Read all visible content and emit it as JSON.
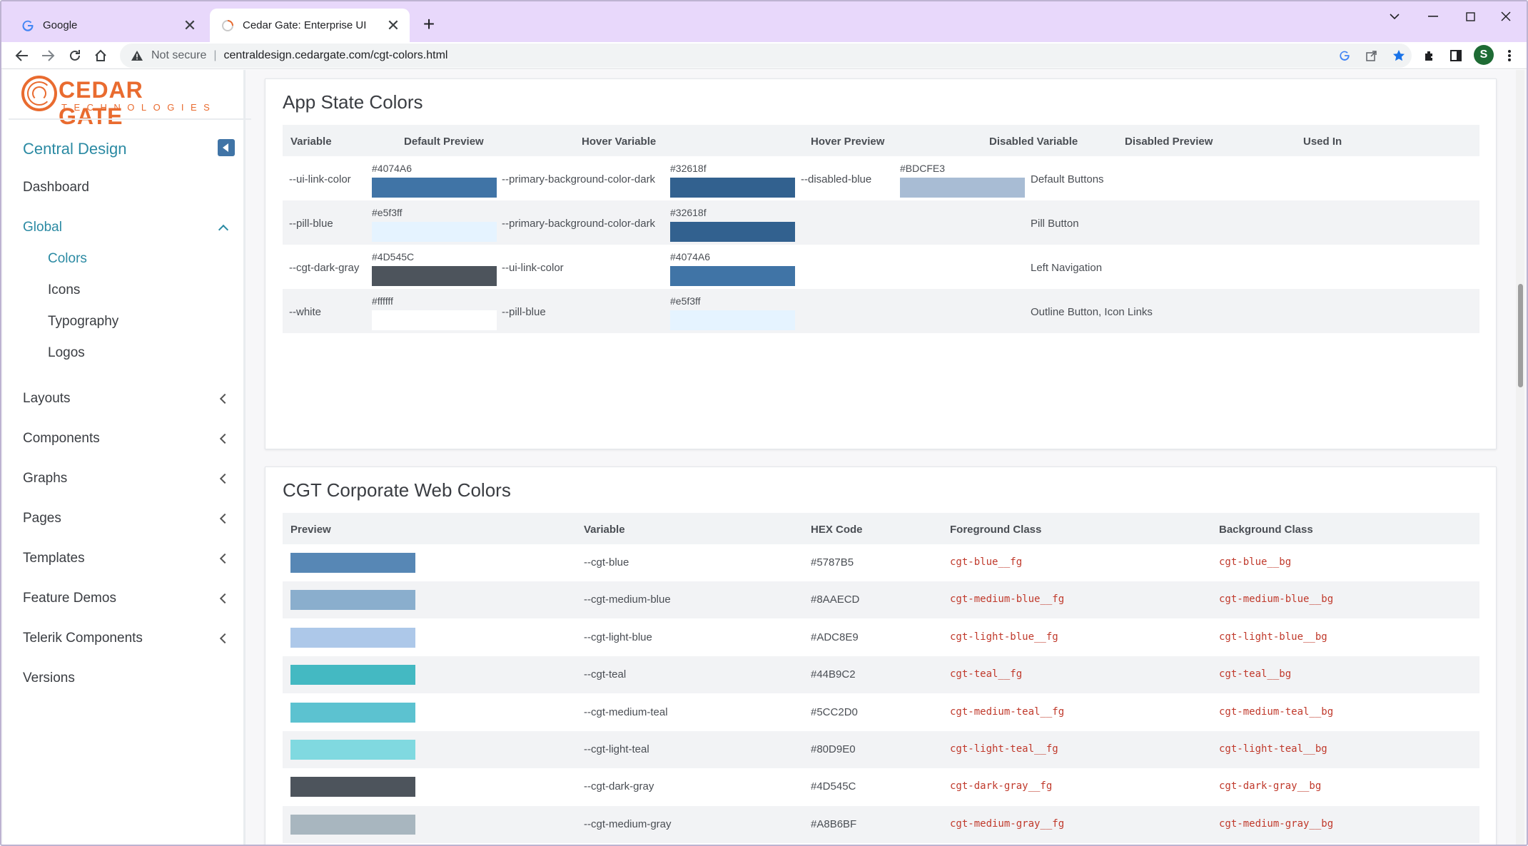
{
  "browser": {
    "tabs": [
      {
        "title": "Google",
        "favicon": "google-icon"
      },
      {
        "title": "Cedar Gate: Enterprise UI",
        "favicon": "loading-icon"
      }
    ],
    "new_tab": "+",
    "address": {
      "security": "Not secure",
      "separator": "|",
      "url": "centraldesign.cedargate.com/cgt-colors.html"
    },
    "profile_initial": "S"
  },
  "logo": {
    "name": "CEDAR GATE",
    "sub": "TECHNOLOGIES"
  },
  "sidebar": {
    "section_title": "Central Design",
    "items": [
      {
        "label": "Dashboard"
      },
      {
        "label": "Global"
      },
      {
        "label": "Layouts"
      },
      {
        "label": "Components"
      },
      {
        "label": "Graphs"
      },
      {
        "label": "Pages"
      },
      {
        "label": "Templates"
      },
      {
        "label": "Feature Demos"
      },
      {
        "label": "Telerik Components"
      },
      {
        "label": "Versions"
      }
    ],
    "global_subitems": [
      {
        "label": "Colors"
      },
      {
        "label": "Icons"
      },
      {
        "label": "Typography"
      },
      {
        "label": "Logos"
      }
    ]
  },
  "app_state": {
    "title": "App State Colors",
    "headers": [
      "Variable",
      "Default Preview",
      "Hover Variable",
      "Hover Preview",
      "Disabled Variable",
      "Disabled Preview",
      "Used In"
    ],
    "rows": [
      {
        "variable": "--ui-link-color",
        "default_hex": "#4074A6",
        "default_color": "#4074A6",
        "hover_variable": "--primary-background-color-dark",
        "hover_hex": "#32618f",
        "hover_color": "#32618f",
        "disabled_variable": "--disabled-blue",
        "disabled_hex": "#BDCFE3",
        "disabled_color": "#A8BCD4",
        "used_in": "Default Buttons"
      },
      {
        "variable": "--pill-blue",
        "default_hex": "#e5f3ff",
        "default_color": "#e5f3ff",
        "hover_variable": "--primary-background-color-dark",
        "hover_hex": "#32618f",
        "hover_color": "#32618f",
        "disabled_variable": "",
        "disabled_hex": "",
        "disabled_color": "",
        "used_in": "Pill Button"
      },
      {
        "variable": "--cgt-dark-gray",
        "default_hex": "#4D545C",
        "default_color": "#4D545C",
        "hover_variable": "--ui-link-color",
        "hover_hex": "#4074A6",
        "hover_color": "#4074A6",
        "disabled_variable": "",
        "disabled_hex": "",
        "disabled_color": "",
        "used_in": "Left Navigation"
      },
      {
        "variable": "--white",
        "default_hex": "#ffffff",
        "default_color": "#ffffff",
        "hover_variable": "--pill-blue",
        "hover_hex": "#e5f3ff",
        "hover_color": "#e5f3ff",
        "disabled_variable": "",
        "disabled_hex": "",
        "disabled_color": "",
        "used_in": "Outline Button, Icon Links"
      }
    ]
  },
  "corporate": {
    "title": "CGT Corporate Web Colors",
    "headers": [
      "Preview",
      "Variable",
      "HEX Code",
      "Foreground Class",
      "Background Class"
    ],
    "rows": [
      {
        "color": "#5787B5",
        "variable": "--cgt-blue",
        "hex": "#5787B5",
        "fg": "cgt-blue__fg",
        "bg": "cgt-blue__bg"
      },
      {
        "color": "#8AAECD",
        "variable": "--cgt-medium-blue",
        "hex": "#8AAECD",
        "fg": "cgt-medium-blue__fg",
        "bg": "cgt-medium-blue__bg"
      },
      {
        "color": "#ADC8E9",
        "variable": "--cgt-light-blue",
        "hex": "#ADC8E9",
        "fg": "cgt-light-blue__fg",
        "bg": "cgt-light-blue__bg"
      },
      {
        "color": "#44B9C2",
        "variable": "--cgt-teal",
        "hex": "#44B9C2",
        "fg": "cgt-teal__fg",
        "bg": "cgt-teal__bg"
      },
      {
        "color": "#5CC2D0",
        "variable": "--cgt-medium-teal",
        "hex": "#5CC2D0",
        "fg": "cgt-medium-teal__fg",
        "bg": "cgt-medium-teal__bg"
      },
      {
        "color": "#80D9E0",
        "variable": "--cgt-light-teal",
        "hex": "#80D9E0",
        "fg": "cgt-light-teal__fg",
        "bg": "cgt-light-teal__bg"
      },
      {
        "color": "#4D545C",
        "variable": "--cgt-dark-gray",
        "hex": "#4D545C",
        "fg": "cgt-dark-gray__fg",
        "bg": "cgt-dark-gray__bg"
      },
      {
        "color": "#A8B6BF",
        "variable": "--cgt-medium-gray",
        "hex": "#A8B6BF",
        "fg": "cgt-medium-gray__fg",
        "bg": "cgt-medium-gray__bg"
      }
    ]
  },
  "colors": {
    "accent": "#2b8aa3",
    "brand_orange": "#e96b2f",
    "tabbar": "#e8d8fb"
  }
}
